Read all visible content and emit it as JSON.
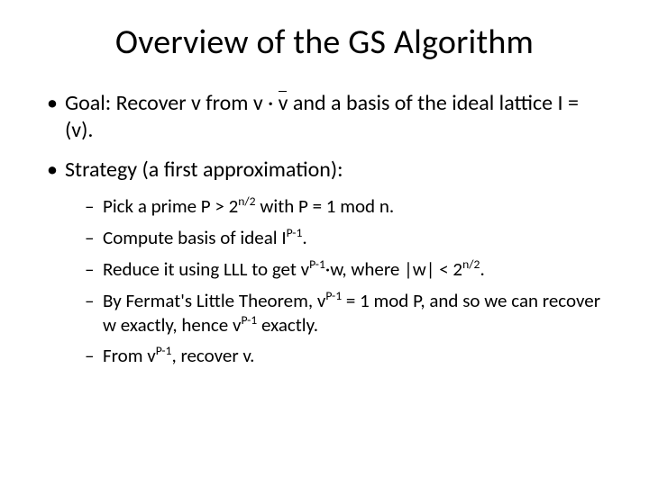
{
  "title": "Overview of the GS Algorithm",
  "bullets": {
    "goal_pre": "Goal: Recover v from v · ",
    "goal_vbar": "v",
    "goal_post": " and a basis of the ideal lattice I = (v).",
    "strategy": "Strategy (a first approximation):",
    "sub": {
      "s1_a": "Pick a prime P > 2",
      "s1_exp": "n/2",
      "s1_b": " with P = 1 mod n.",
      "s2_a": "Compute basis of ideal I",
      "s2_exp": "P-1",
      "s2_b": ".",
      "s3_a": "Reduce it using LLL to get v",
      "s3_exp1": "P-1",
      "s3_b": "·w, where |w| < 2",
      "s3_exp2": "n/2",
      "s3_c": ".",
      "s4_a": "By Fermat's Little Theorem, v",
      "s4_exp1": "P-1",
      "s4_b": " = 1 mod P, and so we can recover w exactly, hence v",
      "s4_exp2": "P-1",
      "s4_c": " exactly.",
      "s5_a": "From v",
      "s5_exp": "P-1",
      "s5_b": ", recover v."
    }
  }
}
